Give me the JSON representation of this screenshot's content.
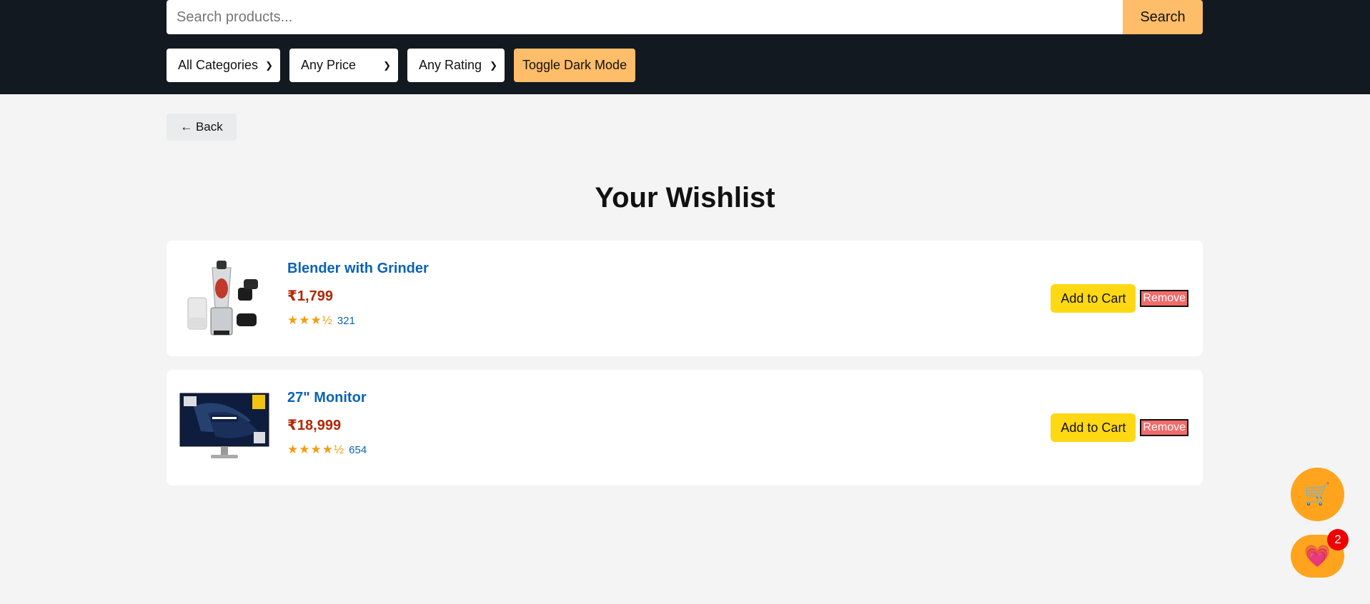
{
  "header": {
    "search": {
      "placeholder": "Search products...",
      "value": "",
      "button_label": "Search"
    },
    "filters": {
      "category": "All Categories",
      "price": "Any Price",
      "rating": "Any Rating"
    },
    "dark_mode_label": "Toggle Dark Mode"
  },
  "nav": {
    "back_label": "← Back"
  },
  "page": {
    "title": "Your Wishlist"
  },
  "wishlist": {
    "items": [
      {
        "name": "Blender with Grinder",
        "price": "₹1,799",
        "stars": "★★★½",
        "rating_value": 3.5,
        "rating_count": "321",
        "add_label": "Add to Cart",
        "remove_label": "Remove"
      },
      {
        "name": "27\" Monitor",
        "price": "₹18,999",
        "stars": "★★★★½",
        "rating_value": 4.5,
        "rating_count": "654",
        "add_label": "Add to Cart",
        "remove_label": "Remove"
      }
    ]
  },
  "floating": {
    "cart_icon": "🛒",
    "wishlist_icon": "💗",
    "wishlist_count": "2"
  },
  "colors": {
    "header_bg": "#131921",
    "accent": "#febd69",
    "add_to_cart": "#ffd814",
    "remove": "#f26b6b",
    "price": "#b12704",
    "link": "#0b63b5",
    "fab": "#ffa41c"
  }
}
